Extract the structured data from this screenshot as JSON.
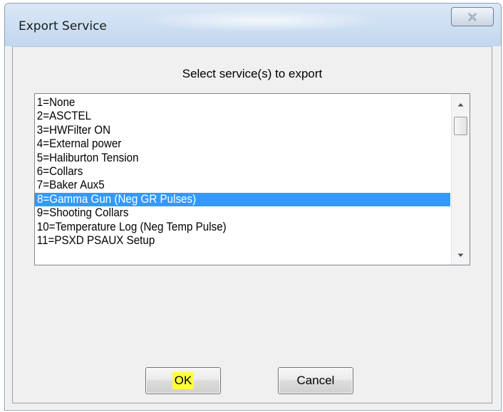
{
  "window": {
    "title": "Export Service"
  },
  "dialog": {
    "prompt": "Select service(s) to export",
    "ok_label": "OK",
    "cancel_label": "Cancel"
  },
  "listbox": {
    "items": [
      "1=None",
      "2=ASCTEL",
      "3=HWFilter ON",
      "4=External power",
      "5=Haliburton Tension",
      "6=Collars",
      "7=Baker Aux5",
      "8=Gamma Gun (Neg GR Pulses)",
      "9=Shooting Collars",
      "10=Temperature Log (Neg Temp Pulse)",
      "11=PSXD PSAUX Setup"
    ],
    "selected_item": "8=Gamma Gun (Neg GR Pulses)"
  },
  "colors": {
    "selection": "#3399ff",
    "ok_highlight": "#ffff40"
  },
  "icons": {
    "close": "close-icon",
    "scroll_up": "scroll-up-arrow-icon",
    "scroll_down": "scroll-down-arrow-icon"
  }
}
